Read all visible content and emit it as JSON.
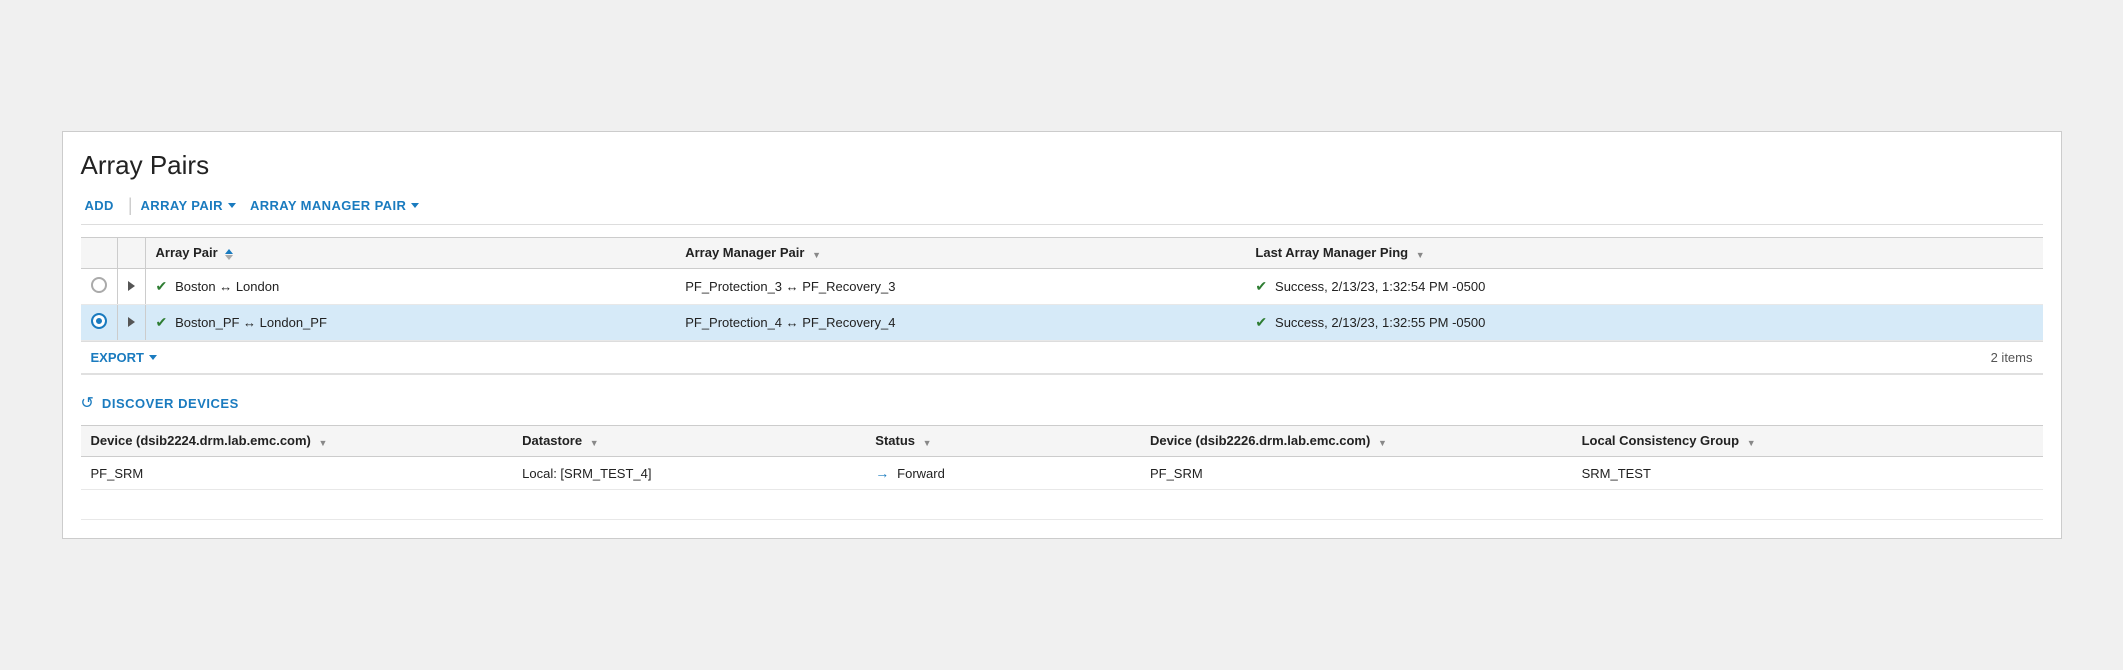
{
  "page": {
    "title": "Array Pairs"
  },
  "toolbar": {
    "add_label": "ADD",
    "array_pair_label": "ARRAY PAIR",
    "array_manager_pair_label": "ARRAY MANAGER PAIR"
  },
  "main_table": {
    "columns": [
      {
        "id": "radio",
        "label": ""
      },
      {
        "id": "expand",
        "label": ""
      },
      {
        "id": "array_pair",
        "label": "Array Pair",
        "sortable": true
      },
      {
        "id": "array_manager_pair",
        "label": "Array Manager Pair",
        "filterable": true
      },
      {
        "id": "last_ping",
        "label": "Last Array Manager Ping",
        "filterable": true
      }
    ],
    "rows": [
      {
        "id": 1,
        "selected": false,
        "array_pair": "Boston ↔ London",
        "array_pair_status": "check",
        "array_manager_pair": "PF_Protection_3 ↔ PF_Recovery_3",
        "last_ping": "Success, 2/13/23, 1:32:54 PM -0500",
        "last_ping_status": "check"
      },
      {
        "id": 2,
        "selected": true,
        "array_pair": "Boston_PF ↔ London_PF",
        "array_pair_status": "check",
        "array_manager_pair": "PF_Protection_4 ↔ PF_Recovery_4",
        "last_ping": "Success, 2/13/23, 1:32:55 PM -0500",
        "last_ping_status": "check"
      }
    ]
  },
  "export_bar": {
    "export_label": "EXPORT",
    "items_count": "2 items"
  },
  "discover": {
    "label": "DISCOVER DEVICES"
  },
  "devices_table": {
    "columns": [
      {
        "id": "device1",
        "label": "Device (dsib2224.drm.lab.emc.com)"
      },
      {
        "id": "datastore",
        "label": "Datastore"
      },
      {
        "id": "status",
        "label": "Status"
      },
      {
        "id": "device2",
        "label": "Device (dsib2226.drm.lab.emc.com)"
      },
      {
        "id": "lcg",
        "label": "Local Consistency Group"
      }
    ],
    "rows": [
      {
        "device1": "PF_SRM",
        "datastore": "Local: [SRM_TEST_4]",
        "status": "→ Forward",
        "status_type": "arrow",
        "device2": "PF_SRM",
        "lcg": "SRM_TEST"
      }
    ]
  },
  "icons": {
    "check": "✔",
    "arrow_right": "→",
    "refresh": "↺"
  }
}
